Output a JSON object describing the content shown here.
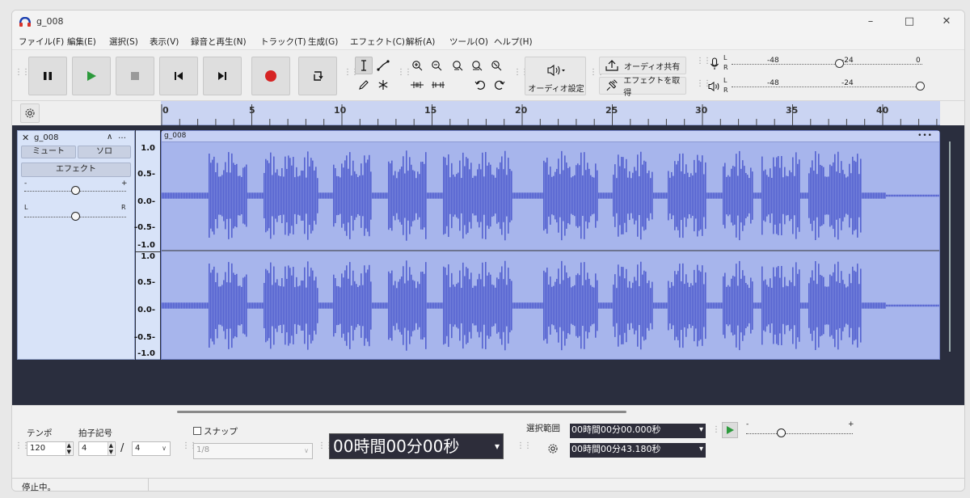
{
  "window": {
    "title": "g_008",
    "minimize": "–",
    "maximize": "□",
    "close": "✕"
  },
  "menu": [
    "ファイル(F)",
    "編集(E)",
    "選択(S)",
    "表示(V)",
    "録音と再生(N)",
    "トラック(T)",
    "生成(G)",
    "エフェクト(C)",
    "解析(A)",
    "ツール(O)",
    "ヘルプ(H)"
  ],
  "toolbar": {
    "transport": [
      "pause-icon",
      "play-icon",
      "stop-icon",
      "skip-start-icon",
      "skip-end-icon",
      "record-icon",
      "loop-icon"
    ],
    "audio_setup_label": "オーディオ設定",
    "share_label": "オーディオ共有",
    "effects_label": "エフェクトを取得",
    "record_meter": {
      "channels": [
        "L",
        "R"
      ],
      "ticks": [
        "-48",
        "-24",
        "0"
      ]
    },
    "play_meter": {
      "channels": [
        "L",
        "R"
      ],
      "ticks": [
        "-48",
        "-24"
      ]
    }
  },
  "ruler": {
    "labels": [
      "0",
      "5",
      "10",
      "15",
      "20",
      "25",
      "30",
      "35",
      "40"
    ]
  },
  "track": {
    "name": "g_008",
    "close": "✕",
    "mute_label": "ミュート",
    "solo_label": "ソロ",
    "effects_label": "エフェクト",
    "gain": {
      "min": "-",
      "max": "+"
    },
    "pan": {
      "left": "L",
      "right": "R"
    },
    "menu_dots": "…",
    "collapse": "∧",
    "clip_name": "g_008",
    "clip_menu": "•••",
    "scale_top": [
      "1.0",
      "0.5-",
      "0.0-",
      "-0.5-",
      "-1.0"
    ],
    "scale_bottom": [
      "1.0",
      "0.5-",
      "0.0-",
      "-0.5-",
      "-1.0"
    ]
  },
  "bottom": {
    "tempo_label": "テンポ",
    "tempo_value": "120",
    "timesig_label": "拍子記号",
    "timesig_num": "4",
    "timesig_slash": "/",
    "timesig_den": "4",
    "snap_label": "スナップ",
    "snap_value": "1/8",
    "time_display": "00時間00分00秒",
    "selection_label": "選択範囲",
    "sel_start": "00時間00分00.000秒",
    "sel_end": "00時間00分43.180秒",
    "speed_min": "-",
    "speed_max": "+"
  },
  "status": {
    "text": "停止中。"
  }
}
